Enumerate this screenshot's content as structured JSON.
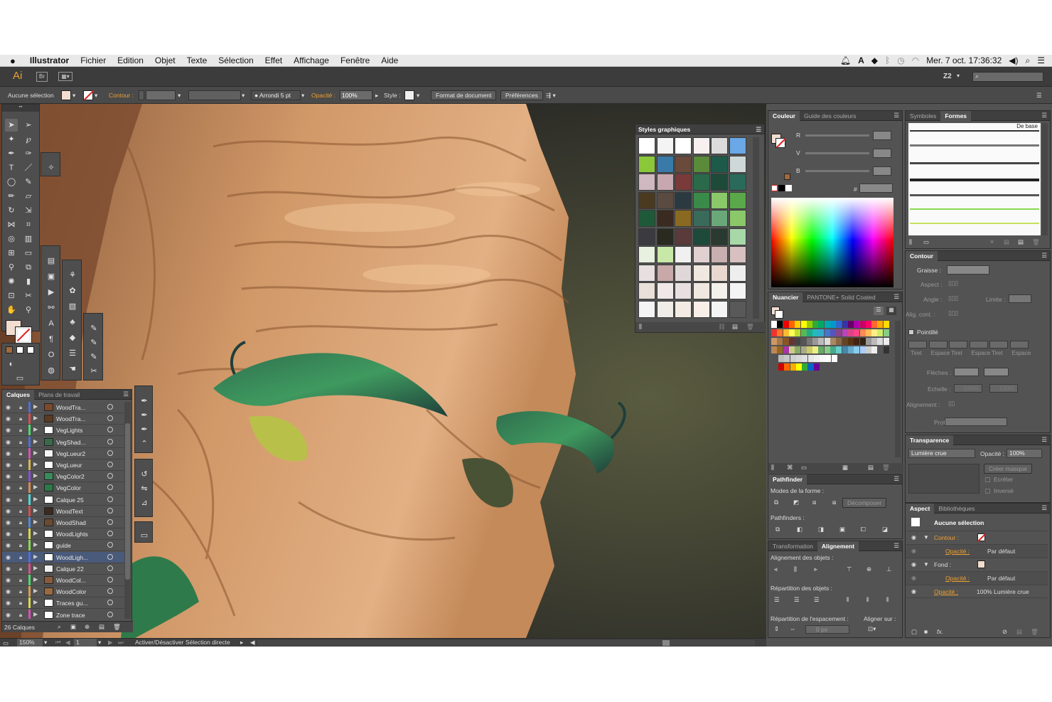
{
  "menubar": {
    "apple": "",
    "app": "Illustrator",
    "items": [
      "Fichier",
      "Edition",
      "Objet",
      "Texte",
      "Sélection",
      "Effet",
      "Affichage",
      "Fenêtre",
      "Aide"
    ],
    "clock": "Mer. 7 oct.  17:36:32"
  },
  "appbar": {
    "logo": "Ai",
    "bridge": "Br",
    "zoom_preset": "Z2"
  },
  "control": {
    "selection": "Aucune sélection",
    "contour_label": "Contour :",
    "brush": "Arrondi 5 pt",
    "opacity_label": "Opacité :",
    "opacity_value": "100%",
    "style_label": "Style :",
    "doc_format": "Format de document",
    "preferences": "Préférences"
  },
  "graphic_styles": {
    "title": "Styles graphiques"
  },
  "color": {
    "tabs": [
      "Couleur",
      "Guide des couleurs"
    ],
    "r": "R",
    "v": "V",
    "b": "B",
    "hash": "#"
  },
  "swatches": {
    "tabs": [
      "Nuancier",
      "PANTONE+ Solid Coated"
    ]
  },
  "symbols": {
    "tabs": [
      "Symboles",
      "Formes"
    ],
    "de_base": "De base"
  },
  "stroke": {
    "title": "Contour",
    "graisse": "Graisse :",
    "aspect": "Aspect :",
    "angle": "Angle :",
    "limite": "Limite :",
    "align": "Alig. cont. :",
    "pointille": "Pointillé",
    "dash_labels": [
      "Tiret",
      "Espace",
      "Tiret",
      "Espace",
      "Tiret",
      "Espace"
    ],
    "fleches": "Flèches :",
    "echelle": "Echelle :",
    "pct1": "100%",
    "pct2": "100%",
    "alignement": "Alignement :",
    "profil": "Profil :"
  },
  "transparency": {
    "title": "Transparence",
    "mode": "Lumière crue",
    "opacity_label": "Opacité :",
    "opacity_value": "100%",
    "mask_button": "Créer masque",
    "ecreter": "Ecrêter",
    "inverse": "Inversé"
  },
  "pathfinder": {
    "title": "Pathfinder",
    "modes": "Modes de la forme :",
    "decompose": "Décomposer",
    "pathfinders": "Pathfinders :"
  },
  "align": {
    "tabs": [
      "Transformation",
      "Alignement"
    ],
    "objects": "Alignement des objets :",
    "distrib": "Répartition des objets :",
    "spacing": "Répartition de l'espacement :",
    "align_to": "Aligner sur :",
    "px": "0 px"
  },
  "appearance": {
    "tabs": [
      "Aspect",
      "Bibliothèques"
    ],
    "selection": "Aucune sélection",
    "contour": "Contour :",
    "opacity1": "Opacité :",
    "par_defaut1": "Par défaut",
    "fond": "Fond :",
    "opacity2": "Opacité :",
    "par_defaut2": "Par défaut",
    "opacity3": "Opacité :",
    "opacity3_value": "100% Lumière crue"
  },
  "layers": {
    "tabs": [
      "Calques",
      "Plans de travail"
    ],
    "rows": [
      {
        "name": "WoodTra...",
        "color": "#4f6fd8",
        "thumb": "#7a4a2a"
      },
      {
        "name": "WoodTra...",
        "color": "#d84f4f",
        "thumb": "#5a3a20"
      },
      {
        "name": "VegLights",
        "color": "#4fd86f",
        "thumb": "#ffffff"
      },
      {
        "name": "VegShad...",
        "color": "#4f6fd8",
        "thumb": "#3a6a4a"
      },
      {
        "name": "VegLueur2",
        "color": "#d84fb8",
        "thumb": "#f4f4f4"
      },
      {
        "name": "VegLueur",
        "color": "#d8b84f",
        "thumb": "#ffffff"
      },
      {
        "name": "VegColor2",
        "color": "#8a4fd8",
        "thumb": "#3a8a5a"
      },
      {
        "name": "VegColor",
        "color": "#d88a4f",
        "thumb": "#2a7a4a"
      },
      {
        "name": "Calque 25",
        "color": "#4fd8d8",
        "thumb": "#ffffff"
      },
      {
        "name": "WoodText",
        "color": "#d84f4f",
        "thumb": "#3a2a20"
      },
      {
        "name": "WoodShad",
        "color": "#4f8ad8",
        "thumb": "#6a4a30"
      },
      {
        "name": "WoodLights",
        "color": "#d8d84f",
        "thumb": "#ffffff"
      },
      {
        "name": "guide",
        "color": "#8ad84f",
        "thumb": "#ffffff"
      },
      {
        "name": "WoodLigh...",
        "color": "#4f6fd8",
        "thumb": "#ffffff"
      },
      {
        "name": "Calque 22",
        "color": "#d84f8a",
        "thumb": "#f0f0f0"
      },
      {
        "name": "WoodCol...",
        "color": "#4fd86f",
        "thumb": "#8a5a3a"
      },
      {
        "name": "WoodColor",
        "color": "#d8a04f",
        "thumb": "#9a6a40"
      },
      {
        "name": "Traces gu...",
        "color": "#d8d84f",
        "thumb": "#ffffff"
      },
      {
        "name": "Zone trace",
        "color": "#d84fb8",
        "thumb": "#ffffff"
      }
    ],
    "count": "26 Calques"
  },
  "status": {
    "zoom": "150%",
    "page": "1",
    "message": "Activer/Désactiver Sélection directe"
  },
  "colors": {
    "accent_orange": "#f0a030",
    "panel_bg": "#535353",
    "canvas_bg": "#3a3a36"
  }
}
